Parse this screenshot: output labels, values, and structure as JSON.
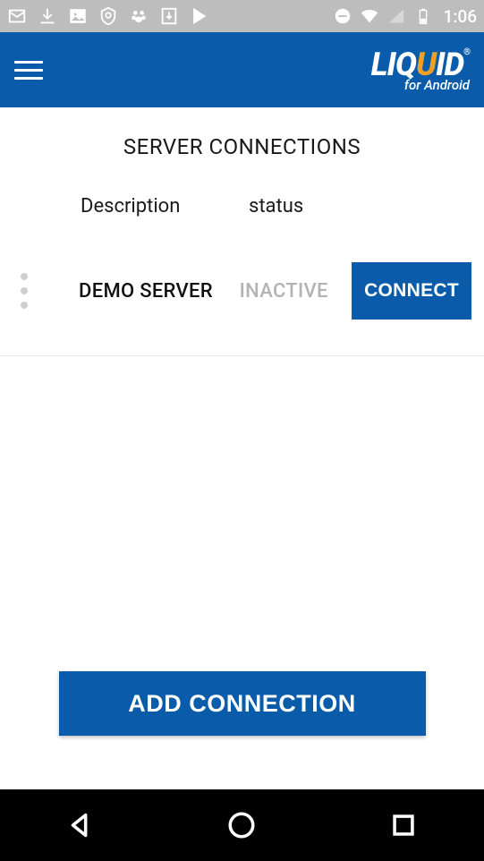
{
  "status_bar": {
    "time": "1:06"
  },
  "app": {
    "logo_part1": "LIQ",
    "logo_part2": "U",
    "logo_part3": "ID",
    "logo_sub": "for Android"
  },
  "page": {
    "title": "SERVER CONNECTIONS",
    "columns": {
      "description": "Description",
      "status": "status"
    },
    "rows": [
      {
        "description": "DEMO SERVER",
        "status": "INACTIVE",
        "action": "CONNECT"
      }
    ],
    "add_button": "ADD CONNECTION"
  }
}
